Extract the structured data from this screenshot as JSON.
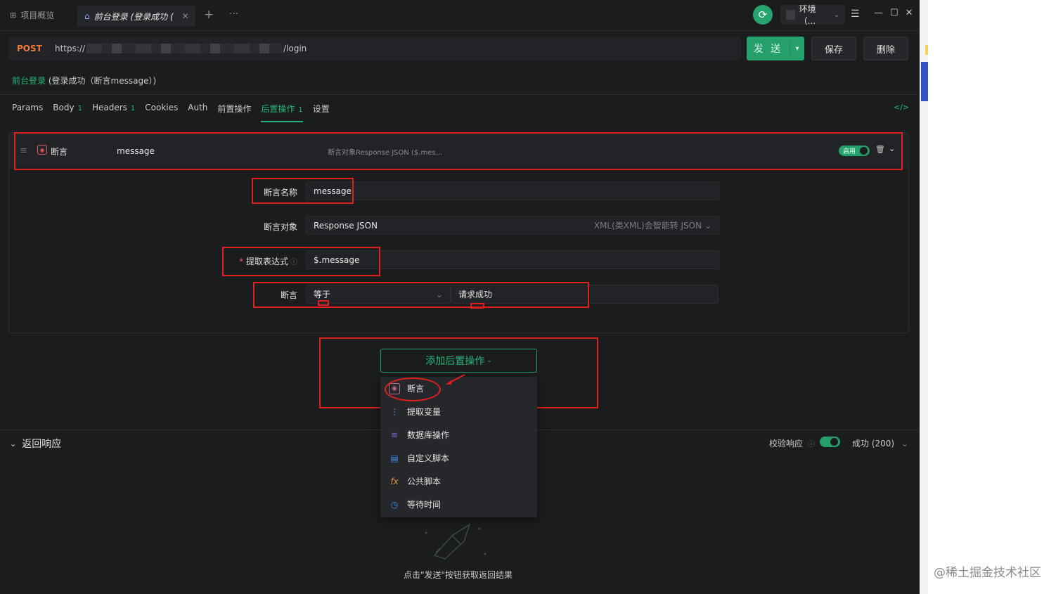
{
  "top": {
    "tab_overview": "项目概览",
    "tab_current": "前台登录 (登录成功 (",
    "tab_close": "✕",
    "plus": "+",
    "more": "···",
    "env": "环境（...",
    "window_controls": [
      "—",
      "☐",
      "✕"
    ]
  },
  "request": {
    "method": "POST",
    "url_prefix": "https://",
    "url_suffix": "/login",
    "send": "发 送",
    "save": "保存",
    "delete": "删除"
  },
  "breadcrumb": {
    "parent": "前台登录",
    "title": "(登录成功（断言message）)"
  },
  "tabs": [
    {
      "label": "Params",
      "count": ""
    },
    {
      "label": "Body",
      "count": "1"
    },
    {
      "label": "Headers",
      "count": "1"
    },
    {
      "label": "Cookies",
      "count": ""
    },
    {
      "label": "Auth",
      "count": ""
    },
    {
      "label": "前置操作",
      "count": ""
    },
    {
      "label": "后置操作",
      "count": "1"
    },
    {
      "label": "设置",
      "count": ""
    }
  ],
  "code_icon": "</>",
  "assertion": {
    "type": "断言",
    "name": "message",
    "description": "断言对象Response JSON ($.mes...",
    "enabled_label": "启用",
    "fields": {
      "name_label": "断言名称",
      "name_value": "message",
      "target_label": "断言对象",
      "target_value": "Response JSON",
      "target_hint": "XML(类XML)会智能转 JSON",
      "expr_required": "*",
      "expr_label": "提取表达式",
      "expr_value": "$.message",
      "assert_label": "断言",
      "op_value": "等于",
      "expected_value": "请求成功"
    }
  },
  "add_post": {
    "button": "添加后置操作",
    "menu": [
      {
        "label": "断言",
        "icon": "assert-icon",
        "glyph": "⊛",
        "color": "#c46b8c"
      },
      {
        "label": "提取变量",
        "icon": "extract-variable-icon",
        "glyph": "⋮",
        "color": "#5b8def"
      },
      {
        "label": "数据库操作",
        "icon": "database-icon",
        "glyph": "≋",
        "color": "#7a6ad6"
      },
      {
        "label": "自定义脚本",
        "icon": "script-icon",
        "glyph": "▤",
        "color": "#3d8ff0"
      },
      {
        "label": "公共脚本",
        "icon": "fx-icon",
        "glyph": "fx",
        "color": "#e0973a"
      },
      {
        "label": "等待时间",
        "icon": "clock-icon",
        "glyph": "◷",
        "color": "#3d8ff0"
      }
    ]
  },
  "response": {
    "title": "返回响应",
    "verify": "校验响应",
    "status": "成功 (200)",
    "hint": "点击\"发送\"按钮获取返回结果"
  },
  "watermark": "@稀土掘金技术社区",
  "colors": {
    "accent": "#27b577",
    "method": "#f07c3a",
    "annotation": "#e01f1f"
  }
}
